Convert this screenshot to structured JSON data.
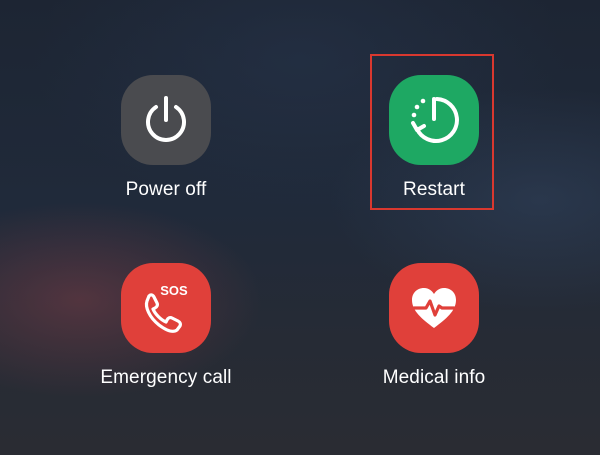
{
  "actions": [
    {
      "id": "power-off",
      "label": "Power off",
      "icon": "power-icon",
      "color": "#4a4b4f"
    },
    {
      "id": "restart",
      "label": "Restart",
      "icon": "restart-icon",
      "color": "#1ea863"
    },
    {
      "id": "emergency-call",
      "label": "Emergency call",
      "icon": "sos-phone-icon",
      "icon_text": "SOS",
      "color": "#e0403a"
    },
    {
      "id": "medical-info",
      "label": "Medical info",
      "icon": "heart-pulse-icon",
      "color": "#e0403a"
    }
  ],
  "highlight": {
    "target": "restart",
    "color": "#d9382f"
  }
}
